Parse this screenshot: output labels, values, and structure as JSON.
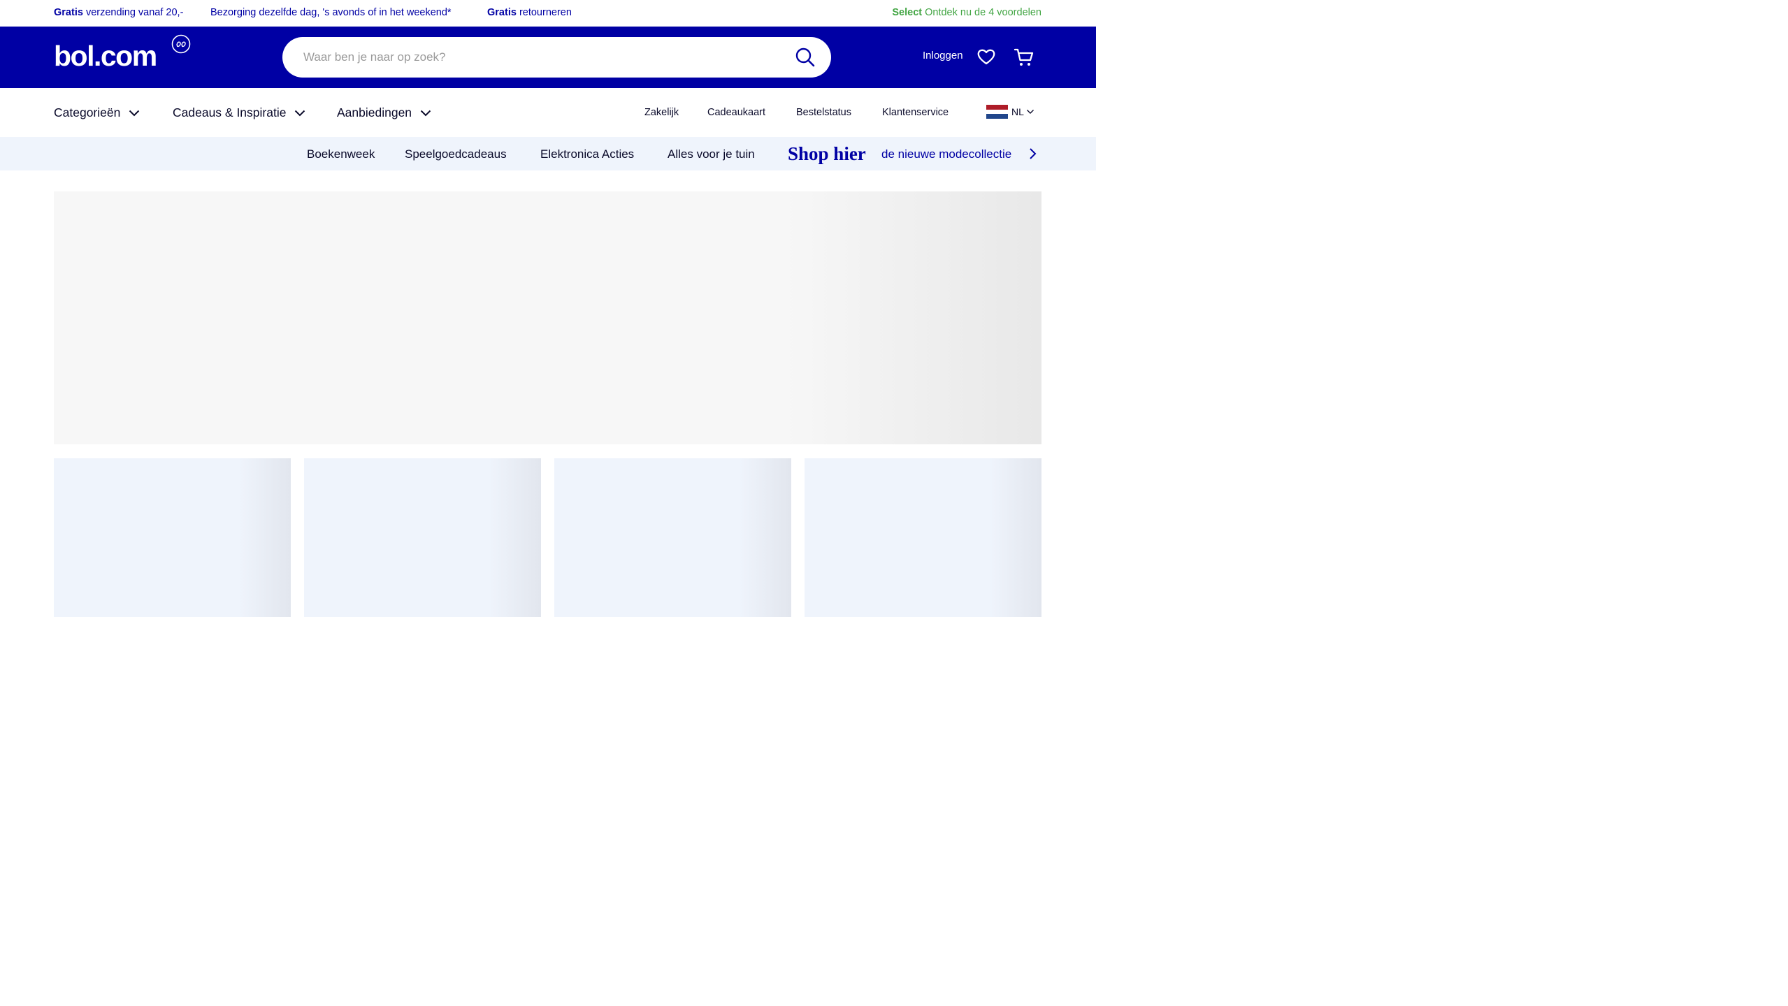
{
  "usp": {
    "shipping_bold": "Gratis",
    "shipping_rest": " verzending vanaf 20,-",
    "delivery": "Bezorging dezelfde dag, 's avonds of in het weekend*",
    "returns_bold": "Gratis",
    "returns_rest": " retourneren",
    "select_bold": "Select",
    "select_rest": " Ontdek nu de 4 voordelen"
  },
  "header": {
    "logo_text": "bol.com",
    "search_placeholder": "Waar ben je naar op zoek?",
    "login_label": "Inloggen"
  },
  "main_nav": {
    "dropdowns": [
      {
        "label": "Categorieën"
      },
      {
        "label": "Cadeaus & Inspiratie"
      },
      {
        "label": "Aanbiedingen"
      }
    ],
    "links": [
      {
        "label": "Zakelijk"
      },
      {
        "label": "Cadeaukaart"
      },
      {
        "label": "Bestelstatus"
      },
      {
        "label": "Klantenservice"
      }
    ],
    "language": "NL"
  },
  "campaign_bar": {
    "links": [
      {
        "label": "Boekenweek"
      },
      {
        "label": "Speelgoedcadeaus"
      },
      {
        "label": "Elektronica Acties"
      },
      {
        "label": "Alles voor je tuin"
      }
    ],
    "shop_title": "Shop hier",
    "shop_subtitle": "de nieuwe modecollectie"
  },
  "icons": {
    "search": "search-icon",
    "wishlist": "heart-icon",
    "cart": "cart-icon",
    "dropdown": "chevron-down-icon",
    "next": "chevron-right-icon",
    "flag": "flag-nl-icon"
  },
  "colors": {
    "brand_blue": "#0000a4",
    "select_green": "#42a543",
    "campaign_bg": "#eff4fc",
    "placeholder_grey": "#f7f7f7",
    "flag_red": "#ae1c28",
    "flag_white": "#ffffff",
    "flag_blue": "#21468b"
  }
}
